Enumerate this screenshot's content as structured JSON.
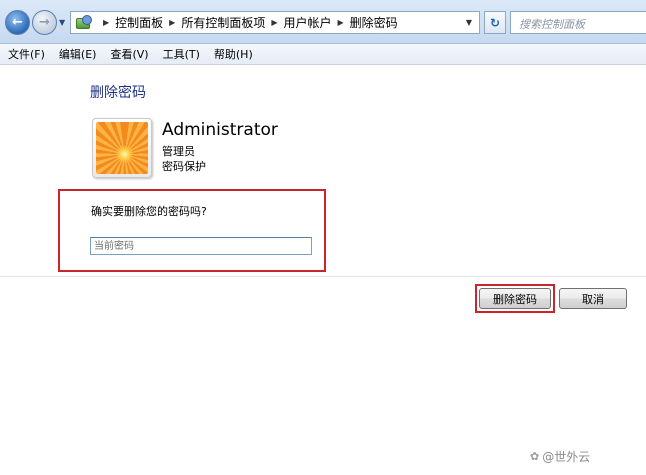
{
  "address_bar": {
    "breadcrumbs": [
      "控制面板",
      "所有控制面板项",
      "用户帐户",
      "删除密码"
    ],
    "search_placeholder": "搜索控制面板"
  },
  "menu": {
    "items": [
      "文件(F)",
      "编辑(E)",
      "查看(V)",
      "工具(T)",
      "帮助(H)"
    ]
  },
  "content": {
    "title": "删除密码",
    "user": {
      "name": "Administrator",
      "role": "管理员",
      "protection": "密码保护"
    },
    "question": "确实要删除您的密码吗?",
    "password_placeholder": "当前密码"
  },
  "buttons": {
    "delete_label": "删除密码",
    "cancel_label": "取消"
  },
  "watermark": {
    "text": "@世外云",
    "icon": "paw-icon"
  },
  "colors": {
    "title_blue": "#1e3287",
    "highlight_red": "#c8262c"
  }
}
